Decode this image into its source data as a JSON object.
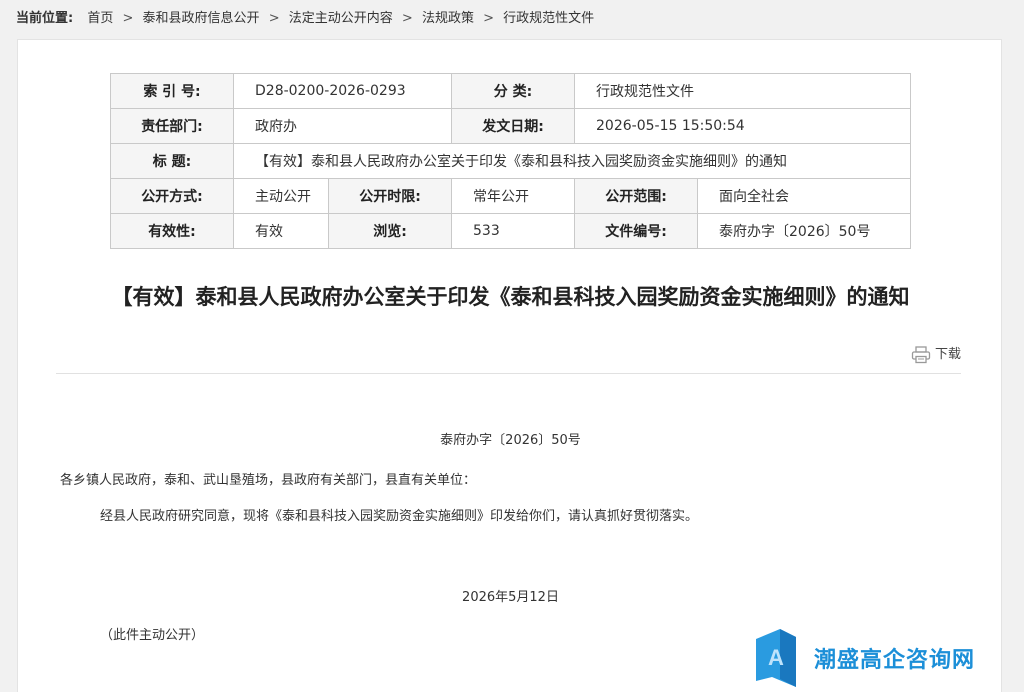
{
  "breadcrumb": {
    "label": "当前位置:",
    "items": [
      "首页",
      "泰和县政府信息公开",
      "法定主动公开内容",
      "法规政策",
      "行政规范性文件"
    ],
    "separator": ">"
  },
  "meta": {
    "index_label": "索 引 号:",
    "index_value": "D28-0200-2026-0293",
    "category_label": "分 类:",
    "category_value": "行政规范性文件",
    "dept_label": "责任部门:",
    "dept_value": "政府办",
    "date_label": "发文日期:",
    "date_value": "2026-05-15 15:50:54",
    "title_label": "标 题:",
    "title_value": "【有效】泰和县人民政府办公室关于印发《泰和县科技入园奖励资金实施细则》的通知",
    "method_label": "公开方式:",
    "method_value": "主动公开",
    "period_label": "公开时限:",
    "period_value": "常年公开",
    "scope_label": "公开范围:",
    "scope_value": "面向全社会",
    "validity_label": "有效性:",
    "validity_value": "有效",
    "views_label": "浏览:",
    "views_value": "533",
    "docno_label": "文件编号:",
    "docno_value": "泰府办字〔2026〕50号"
  },
  "document": {
    "title": "【有效】泰和县人民政府办公室关于印发《泰和县科技入园奖励资金实施细则》的通知",
    "download_label": "下载",
    "number": "泰府办字〔2026〕50号",
    "salutation": "各乡镇人民政府，泰和、武山垦殖场，县政府有关部门，县直有关单位：",
    "paragraph": "经县人民政府研究同意，现将《泰和县科技入园奖励资金实施细则》印发给你们，请认真抓好贯彻落实。",
    "date": "2026年5月12日",
    "public_note": "（此件主动公开）"
  },
  "watermark": {
    "text": "潮盛高企咨询网"
  },
  "colors": {
    "page_bg": "#f1f1f1",
    "label_bg": "#f5f5f5",
    "border": "#c9c9c9",
    "watermark_blue": "#1c8fd8"
  },
  "icons": {
    "print": "printer-icon",
    "logo": "watermark-logo-icon"
  }
}
